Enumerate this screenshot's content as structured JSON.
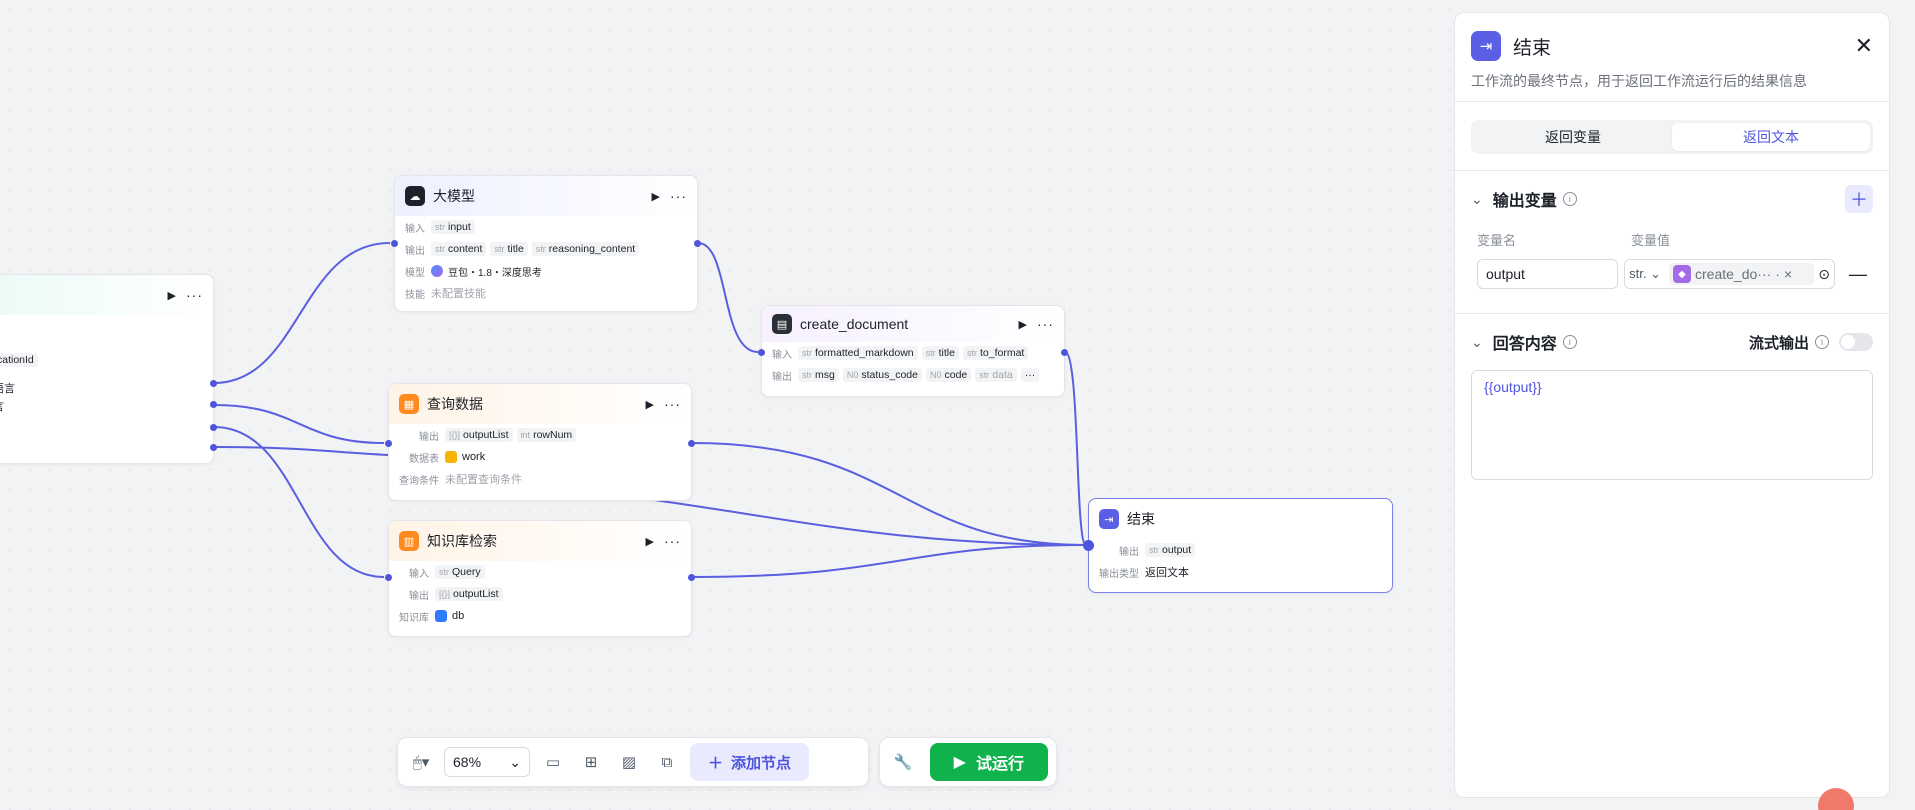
{
  "canvas": {
    "start_node": {
      "title": "",
      "fields": [
        {
          "label": "",
          "value": "cationId"
        },
        {
          "label": "",
          "value": "语言"
        },
        {
          "label": "",
          "value": "言"
        }
      ]
    },
    "llm_node": {
      "title": "大模型",
      "input_label": "输入",
      "input_tags": [
        {
          "type": "str",
          "name": "input"
        }
      ],
      "output_label": "输出",
      "output_tags": [
        {
          "type": "str",
          "name": "content"
        },
        {
          "type": "str",
          "name": "title"
        },
        {
          "type": "str",
          "name": "reasoning_content"
        }
      ],
      "model_label": "模型",
      "model_value": "豆包・1.8・深度思考",
      "skill_label": "技能",
      "skill_value": "未配置技能"
    },
    "doc_node": {
      "title": "create_document",
      "input_label": "输入",
      "input_tags": [
        {
          "type": "str",
          "name": "formatted_markdown"
        },
        {
          "type": "str",
          "name": "title"
        },
        {
          "type": "str",
          "name": "to_format"
        }
      ],
      "output_label": "输出",
      "output_tags": [
        {
          "type": "str",
          "name": "msg"
        },
        {
          "type": "N0",
          "name": "status_code"
        },
        {
          "type": "N0",
          "name": "code"
        },
        {
          "type": "str",
          "name": "data"
        }
      ],
      "more": "···"
    },
    "db_node": {
      "title": "查询数据",
      "output_label": "输出",
      "output_tags": [
        {
          "type": "[{}]",
          "name": "outputList"
        },
        {
          "type": "int",
          "name": "rowNum"
        }
      ],
      "table_label": "数据表",
      "table_value": "work",
      "cond_label": "查询条件",
      "cond_value": "未配置查询条件"
    },
    "kb_node": {
      "title": "知识库检索",
      "input_label": "输入",
      "input_tags": [
        {
          "type": "str",
          "name": "Query"
        }
      ],
      "output_label": "输出",
      "output_tags": [
        {
          "type": "[{}]",
          "name": "outputList"
        }
      ],
      "kb_label": "知识库",
      "kb_value": "db"
    },
    "end_node": {
      "title": "结束",
      "output_label": "输出",
      "output_tags": [
        {
          "type": "str",
          "name": "output"
        }
      ],
      "type_label": "输出类型",
      "type_value": "返回文本"
    }
  },
  "toolbar": {
    "zoom": "68%",
    "add_node": "添加节点",
    "run": "试运行"
  },
  "panel": {
    "title": "结束",
    "description": "工作流的最终节点，用于返回工作流运行后的结果信息",
    "tabs": [
      {
        "label": "返回变量",
        "active": false
      },
      {
        "label": "返回文本",
        "active": true
      }
    ],
    "output_section": {
      "title": "输出变量",
      "col_name": "变量名",
      "col_value": "变量值",
      "var_name": "output",
      "var_type": "str.",
      "var_ref": "create_do···",
      "var_ref_sep": "·"
    },
    "answer_section": {
      "title": "回答内容",
      "stream_label": "流式输出",
      "content": "{{output}}"
    }
  },
  "colors": {
    "accent": "#4e55dc",
    "run_green": "#10b24b",
    "edge": "#5a5fe0"
  }
}
